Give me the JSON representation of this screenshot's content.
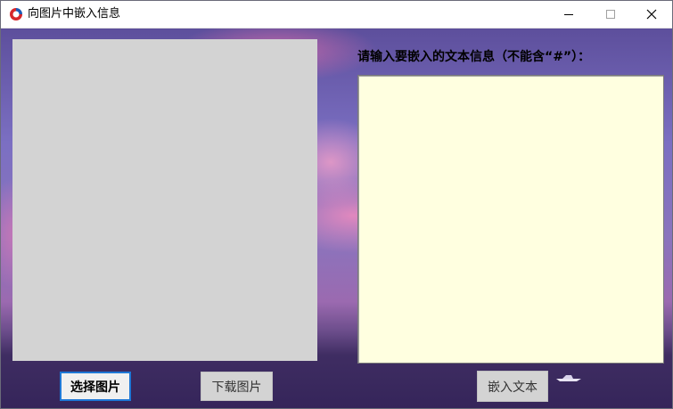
{
  "window": {
    "title": "向图片中嵌入信息",
    "controls": {
      "minimize_icon": "minimize-icon",
      "maximize_icon": "maximize-icon",
      "close_icon": "close-icon"
    }
  },
  "left_panel": {
    "image_placeholder_color": "#d3d3d3"
  },
  "right_panel": {
    "prompt_label": "请输入要嵌入的文本信息（不能含“#”）：",
    "text_value": "",
    "text_background": "#ffffe0"
  },
  "buttons": {
    "select_image": "选择图片",
    "download_image": "下载图片",
    "embed_text": "嵌入文本"
  },
  "colors": {
    "focus_border": "#1e78d6",
    "app_icon_red": "#d6262b",
    "app_icon_blue": "#1f5bb5"
  }
}
